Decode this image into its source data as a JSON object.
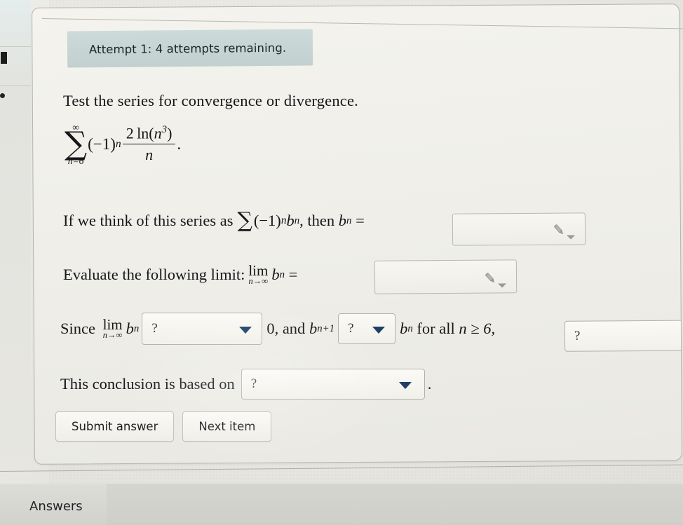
{
  "banner": {
    "text": "Attempt 1: 4 attempts remaining."
  },
  "question": {
    "prompt": "Test the series for convergence or divergence.",
    "series": {
      "sigma_upper": "∞",
      "sigma_symbol": "∑",
      "sigma_lower": "n=6",
      "factor": "(−1)",
      "factor_exponent": "n",
      "numerator_coefficient": "2",
      "numerator_function": "ln(",
      "numerator_variable": "n",
      "numerator_power": "3",
      "numerator_close": ")",
      "denominator": "n",
      "period": "."
    },
    "bn_line": {
      "lead": "If we think of this series as",
      "sum_symbol": "∑",
      "sum_body": "(−1)",
      "sum_exp": "n",
      "sum_term": "b",
      "sum_term_sub": "n",
      "tail": ", then",
      "bn": "b",
      "bn_sub": "n",
      "equals": "="
    },
    "limit_line": {
      "lead": "Evaluate the following limit:",
      "lim": "lim",
      "lim_sub": "n→∞",
      "term": "b",
      "term_sub": "n",
      "equals": "="
    },
    "since_line": {
      "since": "Since",
      "lim": "lim",
      "lim_sub": "n→∞",
      "term": "b",
      "term_sub": "n",
      "zero": "0, and",
      "bnp1": "b",
      "bnp1_sub": "n+1",
      "bn": "b",
      "bn_sub": "n",
      "for_all": "for all",
      "n_cond": "n ≥ 6,"
    },
    "conclusion_line": {
      "lead": "This conclusion is based on",
      "period": "."
    }
  },
  "dropdowns": {
    "placeholder": "?",
    "limit_compare": "?",
    "monotonic_compare": "?",
    "series_result": "?",
    "conclusion_basis": "?"
  },
  "answer_fields": {
    "bn_value": "",
    "limit_value": "",
    "icon": "pencil-icon",
    "caret_icon": "caret-down-icon"
  },
  "buttons": {
    "submit": "Submit answer",
    "next": "Next item"
  },
  "footer": {
    "tab_label": "Answers"
  },
  "colors": {
    "banner_bg": "#c6d4d4",
    "dropdown_caret": "#1f3f66",
    "page_bg": "#eeede7",
    "text": "#16161a"
  }
}
